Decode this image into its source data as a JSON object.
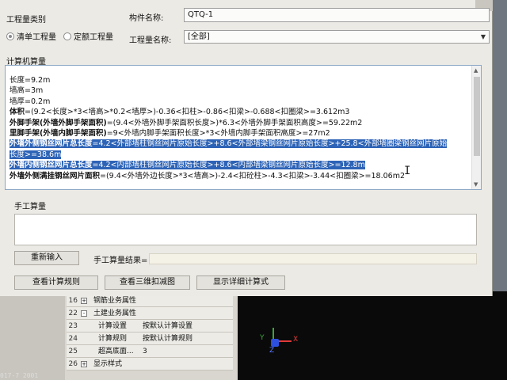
{
  "dialog": {
    "quantity_category_label": "工程量类别",
    "radio_list": "清单工程量",
    "radio_norm": "定额工程量",
    "component_name_label": "构件名称:",
    "component_name_value": "QTQ-1",
    "quantity_name_label": "工程量名称:",
    "quantity_name_value": "[全部]",
    "computer_calc_title": "计算机算量",
    "calc_lines": [
      {
        "text": "长度=9.2m"
      },
      {
        "text": "墙高=3m"
      },
      {
        "text": "墙厚=0.2m"
      },
      {
        "bold": "体积",
        "text": "=(9.2<长度>*3<墙高>*0.2<墙厚>)-0.36<扣柱>-0.86<扣梁>-0.688<扣圈梁>=3.612m3"
      },
      {
        "bold": "外脚手架(外墙外脚手架面积)",
        "text": "=(9.4<外墙外脚手架面积长度>)*6.3<外墙外脚手架面积高度>=59.22m2"
      },
      {
        "bold": "里脚手架(外墙内脚手架面积)",
        "text": "=9<外墙内脚手架面积长度>*3<外墙内脚手架面积高度>=27m2"
      },
      {
        "bold": "外墙外侧钢丝网片总长度",
        "text": "=4.2<外部墙柱钢丝网片原始长度>+8.6<外部墙梁钢丝网片原始长度>+25.8<外部墙圈梁钢丝网片原始",
        "hl": true
      },
      {
        "text": "长度>=38.6m",
        "hl": true
      },
      {
        "bold": "外墙内侧钢丝网片总长度",
        "text": "=4.2<内部墙柱钢丝网片原始长度>+8.6<内部墙梁钢丝网片原始长度>=12.8m",
        "hl": true
      },
      {
        "bold": "外墙外侧满挂钢丝网片面积",
        "text": "=(9.4<外墙外边长度>*3<墙高>)-2.4<扣砼柱>-4.3<扣梁>-3.44<扣圈梁>=18.06m2"
      }
    ],
    "manual_calc_title": "手工算量",
    "reenter_button": "重新输入",
    "manual_result_label": "手工算量结果=",
    "view_rules_button": "查看计算规则",
    "view_3d_button": "查看三维扣减图",
    "show_detail_button": "显示详细计算式"
  },
  "props": {
    "rows": [
      {
        "num": "16",
        "box": "+",
        "name": "钢筋业务属性",
        "val": ""
      },
      {
        "num": "22",
        "box": "-",
        "name": "土建业务属性",
        "val": ""
      },
      {
        "num": "23",
        "box": "",
        "name": "计算设置",
        "val": "按默认计算设置"
      },
      {
        "num": "24",
        "box": "",
        "name": "计算规则",
        "val": "按默认计算规则"
      },
      {
        "num": "25",
        "box": "",
        "name": "超高底面...",
        "val": "3"
      },
      {
        "num": "26",
        "box": "+",
        "name": "显示样式",
        "val": ""
      }
    ],
    "status_text": "017-7  2001"
  },
  "viewport": {
    "x_label": "X",
    "y_label": "Y",
    "z_label": "Z"
  }
}
